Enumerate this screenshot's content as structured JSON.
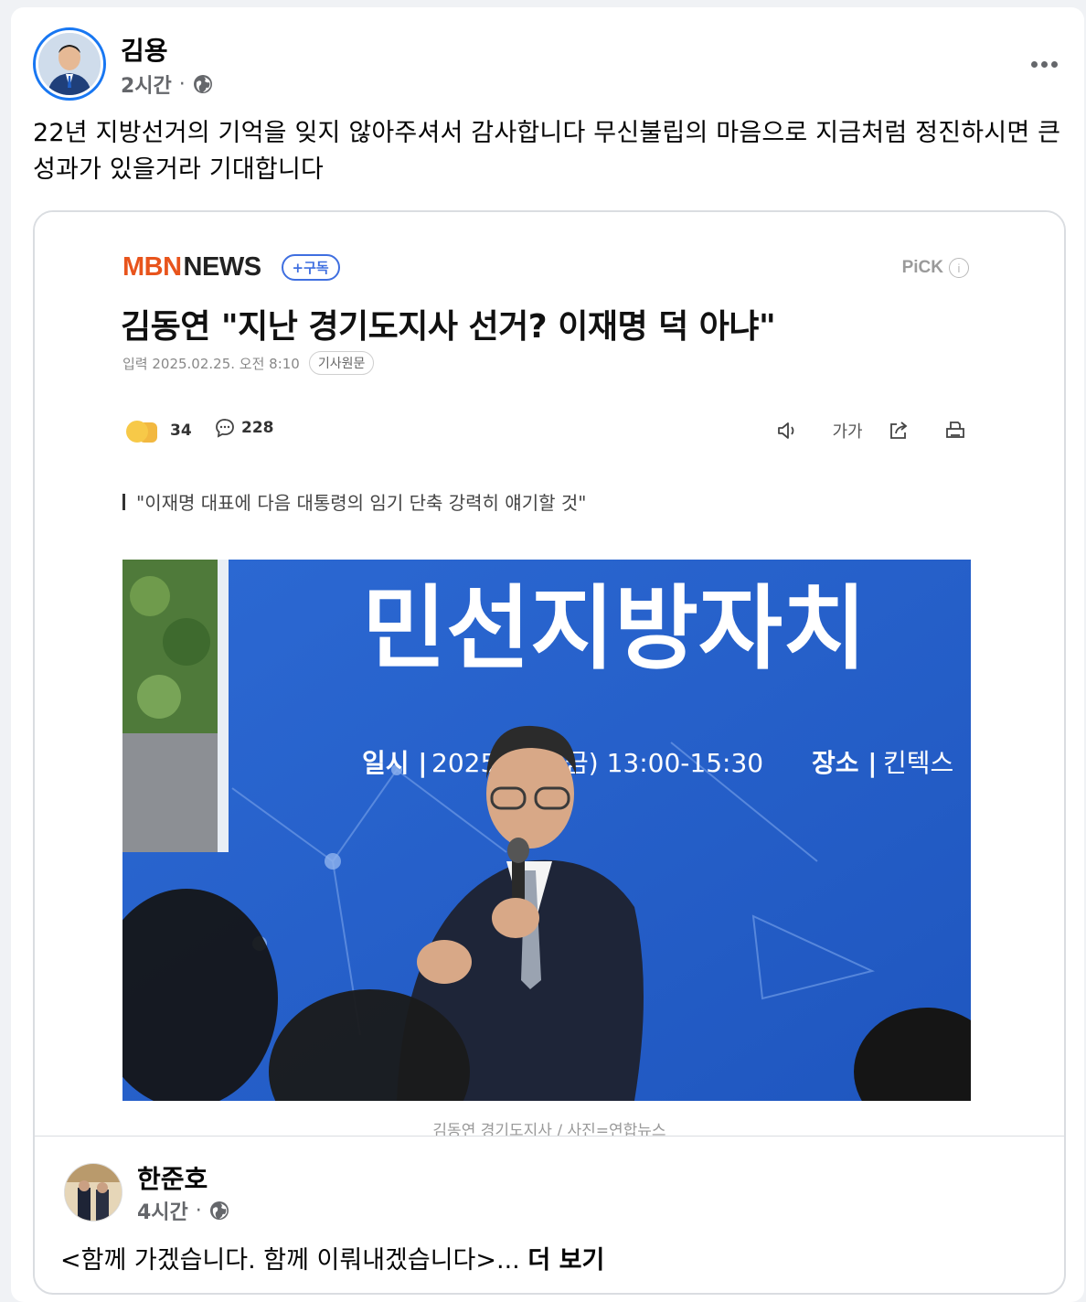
{
  "post": {
    "author": "김용",
    "time": "2시간",
    "separator": "·",
    "text": "22년 지방선거의 기억을 잊지 않아주셔서 감사합니다 무신불립의 마음으로 지금처럼 정진하시면 큰 성과가 있을거라 기대합니다"
  },
  "article": {
    "brand_mbn": "MBN",
    "brand_news": "NEWS",
    "subscribe_label": "+구독",
    "pick_label": "PiCK",
    "headline": "김동연 \"지난 경기도지사 선거? 이재명 덕 아냐\"",
    "dateline": "입력 2025.02.25. 오전 8:10",
    "original_label": "기사원문",
    "reaction_count": "34",
    "comment_count": "228",
    "font_size_label": "가가",
    "subhead": "\"이재명 대표에 다음 대통령의 임기 단축 강력히 얘기할 것\"",
    "banner_text": "민선지방자치",
    "schedule_label": "일시 |",
    "schedule_value": "2025",
    "schedule_time": "금) 13:00-15:30",
    "venue_label": "장소 |",
    "venue_value": "킨텍스",
    "caption": "김동연 경기도지사 / 사진=연합뉴스"
  },
  "shared_post": {
    "author": "한준호",
    "time": "4시간",
    "separator": "·",
    "text": "<함께 가겠습니다. 함께 이뤄내겠습니다>...",
    "see_more": "더 보기"
  },
  "colors": {
    "accent": "#1877f2",
    "mbn_orange": "#e8541c",
    "subscribe_blue": "#3f6fe0",
    "banner_blue": "#2f6ed4"
  },
  "icons": [
    "globe-icon",
    "more-icon",
    "comment-icon",
    "speaker-icon",
    "share-icon",
    "print-icon",
    "info-icon"
  ]
}
